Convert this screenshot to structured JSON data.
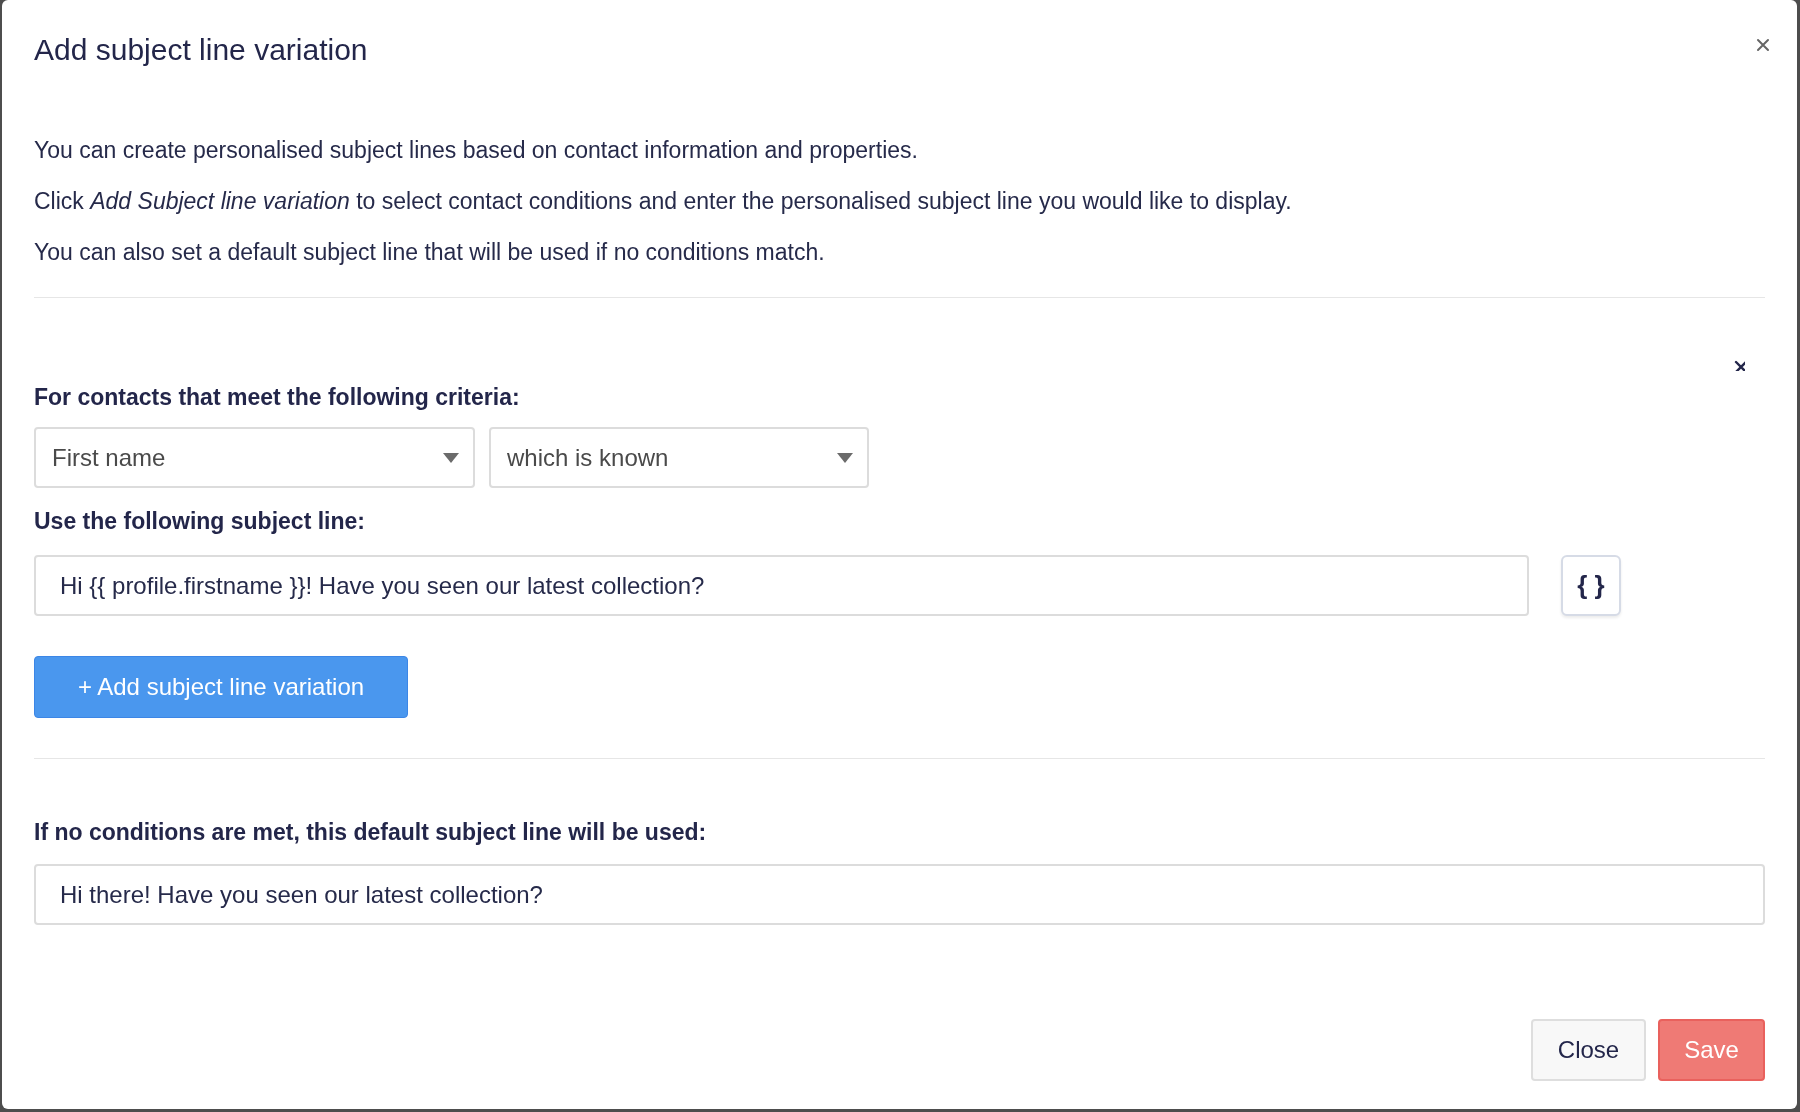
{
  "dialog": {
    "title": "Add subject line variation",
    "intro": [
      "You can create personalised subject lines based on contact information and properties.",
      "Click *Add Subject line variation* to select contact conditions and enter the personalised subject line you would like to display.",
      "You can also set a default subject line that will be used if no conditions match."
    ],
    "variation": {
      "criteria_label": "For contacts that meet the following criteria:",
      "conditions": [
        {
          "value": "First name"
        },
        {
          "value": "which is known"
        }
      ],
      "subject_label": "Use the following subject line:",
      "subject_value": "Hi {{ profile.firstname }}! Have you seen our latest collection?",
      "insert_button": "{ }"
    },
    "add_button": "+ Add subject line variation",
    "default": {
      "label": "If no conditions are met, this default subject line will be used:",
      "value": "Hi there! Have you seen our latest collection?"
    },
    "buttons": [
      {
        "label": "Close",
        "kind": "secondary"
      },
      {
        "label": "Save",
        "kind": "primary"
      }
    ]
  }
}
